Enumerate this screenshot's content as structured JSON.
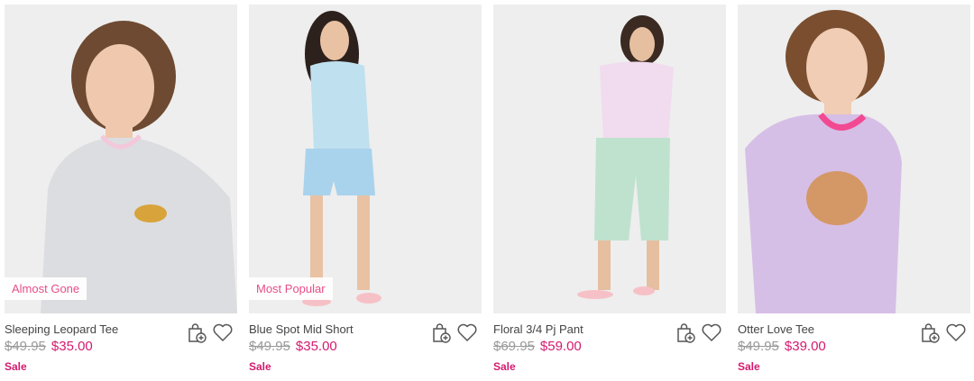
{
  "products": [
    {
      "name": "Sleeping Leopard Tee",
      "was_price": "$49.95",
      "now_price": "$35.00",
      "sale_label": "Sale",
      "badge": "Almost Gone",
      "colors": {
        "top": "#dcdde0",
        "trim": "#f3c8da",
        "bottom": "#dcdde0",
        "hair": "#6e4a32"
      }
    },
    {
      "name": "Blue Spot Mid Short",
      "was_price": "$49.95",
      "now_price": "$35.00",
      "sale_label": "Sale",
      "badge": "Most Popular",
      "colors": {
        "top": "#bfe0ef",
        "trim": "#bfe0ef",
        "bottom": "#a9d3ec",
        "hair": "#2c211c"
      }
    },
    {
      "name": "Floral 3/4 Pj Pant",
      "was_price": "$69.95",
      "now_price": "$59.00",
      "sale_label": "Sale",
      "badge": "",
      "colors": {
        "top": "#f1dbee",
        "trim": "#f1dbee",
        "bottom": "#bfe2cf",
        "hair": "#3a2a22"
      }
    },
    {
      "name": "Otter Love Tee",
      "was_price": "$49.95",
      "now_price": "$39.00",
      "sale_label": "Sale",
      "badge": "",
      "colors": {
        "top": "#d6bfe6",
        "trim": "#f24a92",
        "bottom": "#d6bfe6",
        "hair": "#7a4e2f"
      }
    }
  ],
  "icons": {
    "bag": "shopping-bag-add-icon",
    "wishlist": "heart-icon"
  }
}
